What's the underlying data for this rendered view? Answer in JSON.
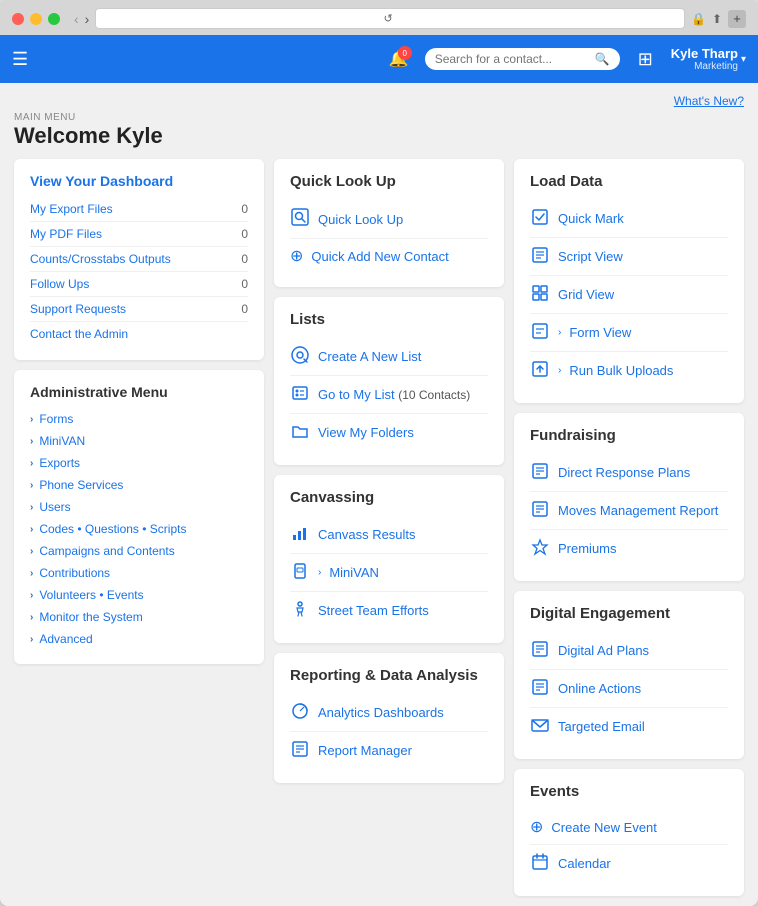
{
  "browser": {
    "address": "reload-icon",
    "lock_icon": "🔒"
  },
  "header": {
    "notification_count": "0",
    "search_placeholder": "Search for a contact...",
    "user_name": "Kyle Tharp",
    "user_role": "Marketing",
    "whats_new": "What's New?"
  },
  "page": {
    "main_menu_label": "MAIN MENU",
    "welcome_title": "Welcome Kyle"
  },
  "dashboard": {
    "title": "View Your Dashboard",
    "items": [
      {
        "label": "My Export Files",
        "count": "0"
      },
      {
        "label": "My PDF Files",
        "count": "0"
      },
      {
        "label": "Counts/Crosstabs Outputs",
        "count": "0"
      },
      {
        "label": "Follow Ups",
        "count": "0"
      },
      {
        "label": "Support Requests",
        "count": "0"
      },
      {
        "label": "Contact the Admin",
        "count": ""
      }
    ]
  },
  "admin_menu": {
    "title": "Administrative Menu",
    "items": [
      "Forms",
      "MiniVAN",
      "Exports",
      "Phone Services",
      "Users",
      "Codes • Questions • Scripts",
      "Campaigns and Contents",
      "Contributions",
      "Volunteers • Events",
      "Monitor the System",
      "Advanced"
    ]
  },
  "quick_lookup": {
    "title": "Quick Look Up",
    "links": [
      {
        "label": "Quick Look Up",
        "icon": "magnify"
      },
      {
        "label": "Quick Add New Contact",
        "icon": "plus-circle"
      }
    ]
  },
  "lists": {
    "title": "Lists",
    "links": [
      {
        "label": "Create A New List",
        "icon": "magnify-circle"
      },
      {
        "label": "Go to My List",
        "badge": "(10 Contacts)",
        "icon": "contact"
      },
      {
        "label": "View My Folders",
        "icon": "folder"
      }
    ]
  },
  "canvassing": {
    "title": "Canvassing",
    "links": [
      {
        "label": "Canvass Results",
        "icon": "chart-bar"
      },
      {
        "label": "MiniVAN",
        "icon": "phone",
        "has_chevron": true
      },
      {
        "label": "Street Team Efforts",
        "icon": "walk"
      }
    ]
  },
  "reporting": {
    "title": "Reporting & Data Analysis",
    "links": [
      {
        "label": "Analytics Dashboards",
        "icon": "globe"
      },
      {
        "label": "Report Manager",
        "icon": "grid-doc"
      }
    ]
  },
  "load_data": {
    "title": "Load Data",
    "links": [
      {
        "label": "Quick Mark",
        "icon": "doc"
      },
      {
        "label": "Script View",
        "icon": "lines"
      },
      {
        "label": "Grid View",
        "icon": "grid"
      },
      {
        "label": "Form View",
        "icon": "form",
        "has_chevron": true
      },
      {
        "label": "Run Bulk Uploads",
        "icon": "upload",
        "has_chevron": true
      }
    ]
  },
  "fundraising": {
    "title": "Fundraising",
    "links": [
      {
        "label": "Direct Response Plans",
        "icon": "doc"
      },
      {
        "label": "Moves Management Report",
        "icon": "lines"
      },
      {
        "label": "Premiums",
        "icon": "gift"
      }
    ]
  },
  "digital_engagement": {
    "title": "Digital Engagement",
    "links": [
      {
        "label": "Digital Ad Plans",
        "icon": "doc"
      },
      {
        "label": "Online Actions",
        "icon": "lines"
      },
      {
        "label": "Targeted Email",
        "icon": "email"
      }
    ]
  },
  "events": {
    "title": "Events",
    "links": [
      {
        "label": "Create New Event",
        "icon": "plus-circle"
      },
      {
        "label": "Calendar",
        "icon": "cal"
      }
    ]
  }
}
